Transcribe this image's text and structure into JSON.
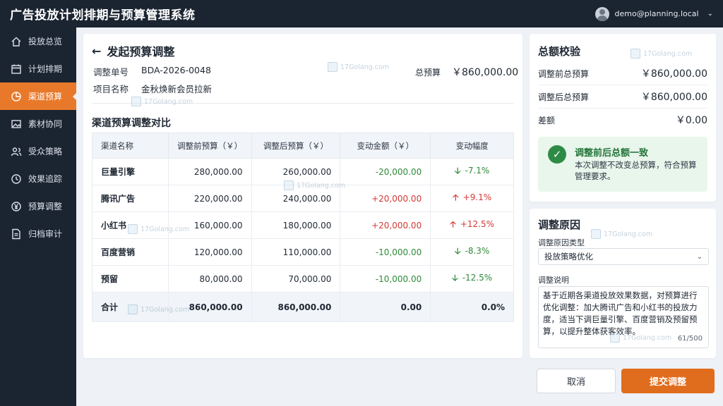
{
  "app": {
    "title": "广告投放计划排期与预算管理系统",
    "user": "demo@planning.local"
  },
  "sidebar": {
    "items": [
      {
        "label": "投放总览",
        "icon": "home-icon"
      },
      {
        "label": "计划排期",
        "icon": "calendar-icon"
      },
      {
        "label": "渠道预算",
        "icon": "budget-icon"
      },
      {
        "label": "素材协同",
        "icon": "image-icon"
      },
      {
        "label": "受众策略",
        "icon": "users-icon"
      },
      {
        "label": "效果追踪",
        "icon": "clock-icon"
      },
      {
        "label": "预算调整",
        "icon": "yen-icon"
      },
      {
        "label": "归档审计",
        "icon": "document-icon"
      }
    ],
    "active_index": 2
  },
  "main": {
    "title": "发起预算调整",
    "adjust_no_label": "调整单号",
    "adjust_no": "BDA-2026-0048",
    "project_label": "项目名称",
    "project": "金秋焕新会员拉新",
    "total_label": "总预算",
    "total_value": "￥860,000.00",
    "section_title": "渠道预算调整对比",
    "table": {
      "headers": [
        "渠道名称",
        "调整前预算（￥）",
        "调整后预算（￥）",
        "变动金额（￥）",
        "变动幅度"
      ],
      "rows": [
        {
          "name": "巨量引擎",
          "before": "280,000.00",
          "after": "260,000.00",
          "delta": "-20,000.00",
          "pct": "-7.1%"
        },
        {
          "name": "腾讯广告",
          "before": "220,000.00",
          "after": "240,000.00",
          "delta": "+20,000.00",
          "pct": "+9.1%"
        },
        {
          "name": "小红书",
          "before": "160,000.00",
          "after": "180,000.00",
          "delta": "+20,000.00",
          "pct": "+12.5%"
        },
        {
          "name": "百度营销",
          "before": "120,000.00",
          "after": "110,000.00",
          "delta": "-10,000.00",
          "pct": "-8.3%"
        },
        {
          "name": "预留",
          "before": "80,000.00",
          "after": "70,000.00",
          "delta": "-10,000.00",
          "pct": "-12.5%"
        }
      ],
      "total": {
        "name": "合计",
        "before": "860,000.00",
        "after": "860,000.00",
        "delta": "0.00",
        "pct": "0.0%"
      }
    }
  },
  "check": {
    "title": "总额校验",
    "before_label": "调整前总预算",
    "before_value": "￥860,000.00",
    "after_label": "调整后总预算",
    "after_value": "￥860,000.00",
    "diff_label": "差额",
    "diff_value": "￥0.00",
    "ok_title": "调整前后总额一致",
    "ok_desc": "本次调整不改变总预算，符合预算管理要求。"
  },
  "reason": {
    "title": "调整原因",
    "type_label": "调整原因类型",
    "type_value": "投放策略优化",
    "desc_label": "调整说明",
    "desc_value": "基于近期各渠道投放效果数据，对预算进行优化调整：加大腾讯广告和小红书的投放力度，适当下调巨量引擎、百度营销及预留预算，以提升整体获客效率。",
    "counter": "61/500"
  },
  "actions": {
    "cancel": "取消",
    "submit": "提交调整"
  },
  "watermark": "17Golang.com",
  "colors": {
    "accent": "#e8792b",
    "sidebar_bg": "#1b2431",
    "positive": "#d13a34",
    "negative": "#2f8a3a",
    "success_bg": "#e9f6ec"
  }
}
